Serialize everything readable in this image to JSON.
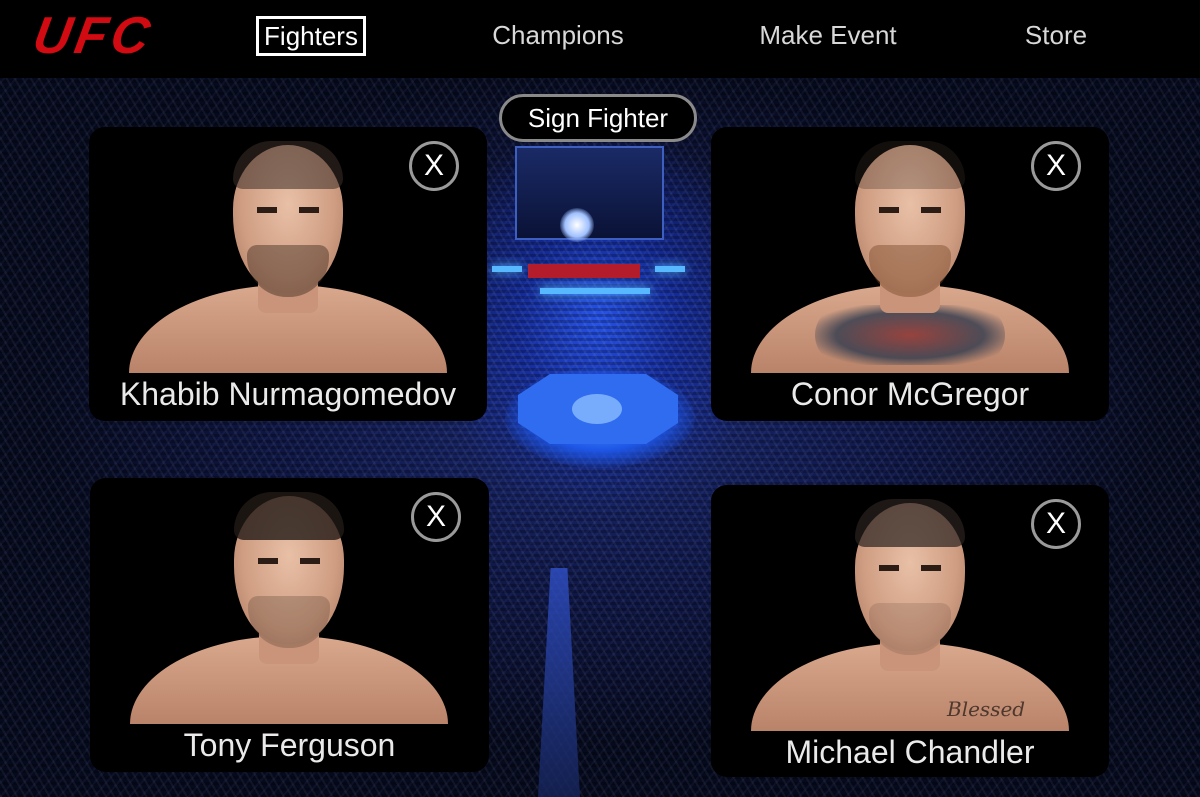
{
  "nav": {
    "logo_text": "UFC",
    "items": [
      {
        "label": "Fighters",
        "active": true
      },
      {
        "label": "Champions",
        "active": false
      },
      {
        "label": "Make Event",
        "active": false
      },
      {
        "label": "Store",
        "active": false
      }
    ]
  },
  "actions": {
    "sign_fighter_label": "Sign Fighter"
  },
  "fighters": [
    {
      "name": "Khabib Nurmagomedov",
      "remove_label": "X"
    },
    {
      "name": "Conor McGregor",
      "remove_label": "X"
    },
    {
      "name": "Tony Ferguson",
      "remove_label": "X"
    },
    {
      "name": "Michael Chandler",
      "remove_label": "X",
      "tattoo_text": "Blessed"
    }
  ],
  "colors": {
    "brand_red": "#d20a11",
    "arena_blue": "#2f6cf0",
    "card_bg": "#000000"
  }
}
